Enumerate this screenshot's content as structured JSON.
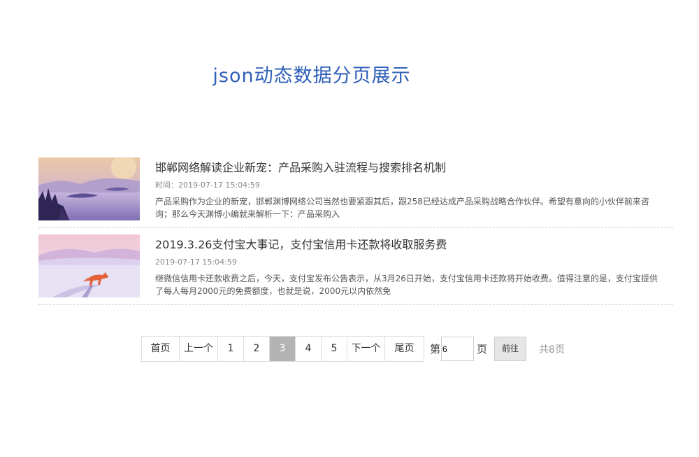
{
  "page": {
    "title": "json动态数据分页展示"
  },
  "news": [
    {
      "title": "邯郸网络解读企业新宠：产品采购入驻流程与搜索排名机制",
      "time": "时间：2019-07-17 15:04:59",
      "summary": "产品采购作为企业的新宠，邯郸渊博网络公司当然也要紧跟其后，跟258已经达成产品采购战略合作伙伴。希望有意向的小伙伴前来咨询；那么今天渊博小编就来解析一下：产品采购入",
      "thumb": "landscape-thumbnail"
    },
    {
      "title": "2019.3.26支付宝大事记，支付宝信用卡还款将收取服务费",
      "time": "2019-07-17 15:04:59",
      "summary": "继微信信用卡还款收费之后，今天，支付宝发布公告表示，从3月26日开始，支付宝信用卡还款将开始收费。值得注意的是，支付宝提供了每人每月2000元的免费额度，也就是说，2000元以内依然免",
      "thumb": "fox-thumbnail"
    }
  ],
  "pager": {
    "first": "首页",
    "prev": "上一个",
    "pages": [
      "1",
      "2",
      "3",
      "4",
      "5"
    ],
    "current": "3",
    "next": "下一个",
    "last": "尾页",
    "jump_prefix": "第",
    "jump_value": "6",
    "jump_suffix": "页",
    "go": "前往",
    "total": "共8页"
  },
  "colors": {
    "title": "#2f5fb8",
    "active_page": "#b3b3b3"
  }
}
